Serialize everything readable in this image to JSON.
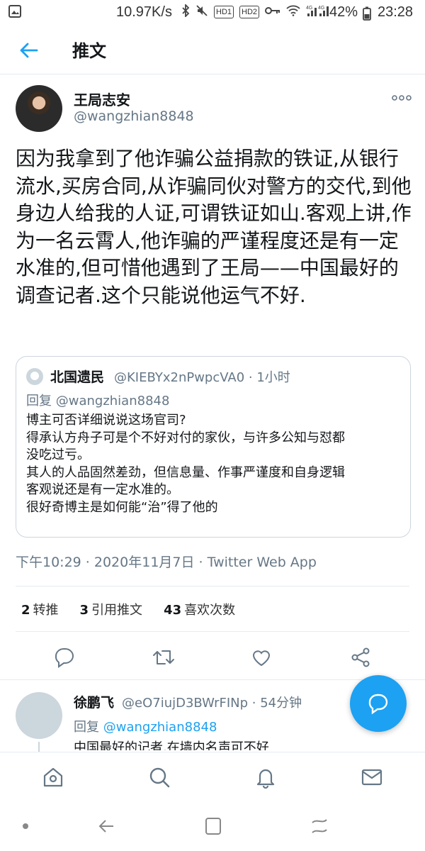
{
  "status_bar": {
    "speed": "10.97K/s",
    "hd1": "HD1",
    "hd2": "HD2",
    "signal": "4G",
    "battery": "42%",
    "time": "23:28"
  },
  "header": {
    "title": "推文"
  },
  "tweet": {
    "author_name": "王局志安",
    "author_handle": "@wangzhian8848",
    "text": "因为我拿到了他诈骗公益捐款的铁证,从银行流水,买房合同,从诈骗同伙对警方的交代,到他身边人给我的人证,可谓铁证如山.客观上讲,作为一名云霄人,他诈骗的严谨程度还是有一定水准的,但可惜他遇到了王局——中国最好的调查记者.这个只能说他运气不好.",
    "meta": "下午10:29 · 2020年11月7日 · Twitter Web App",
    "stats": {
      "retweets": "2",
      "retweets_label": "转推",
      "quotes": "3",
      "quotes_label": "引用推文",
      "likes": "43",
      "likes_label": "喜欢次数"
    }
  },
  "quote": {
    "name": "北国遗民",
    "handle_time": "@KIEBYx2nPwpcVA0 · 1小时",
    "reply_prefix": "回复",
    "reply_to": "@wangzhian8848",
    "lines": [
      "博主可否详细说说这场官司?",
      "得承认方舟子可是个不好对付的家伙，与许多公知与怼都",
      "没吃过亏。",
      "其人的人品固然差劲，但信息量、作事严谨度和自身逻辑",
      "客观说还是有一定水准的。",
      "很好奇博主是如何能“治”得了他的"
    ]
  },
  "reply": {
    "name": "徐鹏飞",
    "handle_time": "@eO7iujD3BWrFINp · 54分钟",
    "reply_prefix": "回复",
    "reply_to": "@wangzhian8848",
    "text": "中国最好的记者,在墙内名声可不好"
  },
  "colors": {
    "accent": "#1da1f2",
    "muted": "#657786",
    "icon": "#657786",
    "text": "#14171a"
  }
}
